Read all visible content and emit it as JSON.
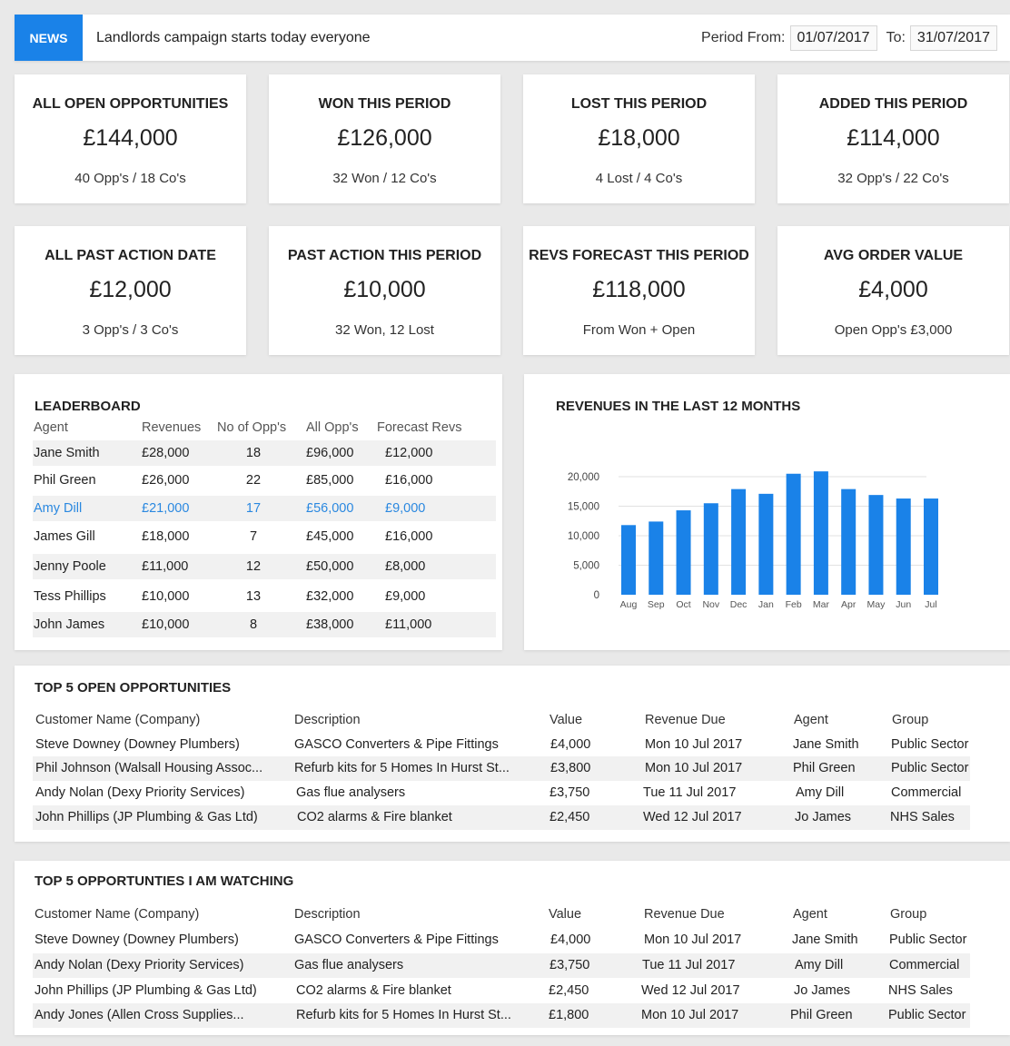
{
  "news": {
    "badge": "NEWS",
    "message": "Landlords campaign starts today everyone",
    "period_from_label": "Period From:",
    "period_from_value": "01/07/2017",
    "period_to_label": "To:",
    "period_to_value": "31/07/2017"
  },
  "kpis": [
    {
      "title": "ALL OPEN OPPORTUNITIES",
      "value": "£144,000",
      "sub": "40 Opp's  / 18 Co's"
    },
    {
      "title": "WON THIS PERIOD",
      "value": "£126,000",
      "sub": "32 Won / 12 Co's"
    },
    {
      "title": "LOST THIS PERIOD",
      "value": "£18,000",
      "sub": "4 Lost / 4 Co's"
    },
    {
      "title": "ADDED THIS PERIOD",
      "value": "£114,000",
      "sub": "32 Opp's  / 22 Co's"
    },
    {
      "title": "ALL PAST ACTION DATE",
      "value": "£12,000",
      "sub": "3 Opp's  / 3 Co's"
    },
    {
      "title": "PAST ACTION THIS PERIOD",
      "value": "£10,000",
      "sub": "32 Won, 12 Lost"
    },
    {
      "title": "REVS FORECAST THIS PERIOD",
      "value": "£118,000",
      "sub": "From Won + Open"
    },
    {
      "title": "AVG ORDER VALUE",
      "value": "£4,000",
      "sub": "Open Opp's £3,000"
    }
  ],
  "leaderboard": {
    "title": "LEADERBOARD",
    "headers": [
      "Agent",
      "Revenues",
      "No of Opp's",
      "All Opp's",
      "Forecast Revs"
    ],
    "rows": [
      {
        "agent": "Jane Smith",
        "revenues": "£28,000",
        "opps": "18",
        "all": "£96,000",
        "forecast": "£12,000"
      },
      {
        "agent": "Phil Green",
        "revenues": "£26,000",
        "opps": "22",
        "all": "£85,000",
        "forecast": "£16,000"
      },
      {
        "agent": "Amy Dill",
        "revenues": "£21,000",
        "opps": "17",
        "all": "£56,000",
        "forecast": "£9,000"
      },
      {
        "agent": "James Gill",
        "revenues": "£18,000",
        "opps": "7",
        "all": "£45,000",
        "forecast": "£16,000"
      },
      {
        "agent": "Jenny Poole",
        "revenues": "£11,000",
        "opps": "12",
        "all": "£50,000",
        "forecast": "£8,000"
      },
      {
        "agent": "Tess Phillips",
        "revenues": "£10,000",
        "opps": "13",
        "all": "£32,000",
        "forecast": "£9,000"
      },
      {
        "agent": "John James",
        "revenues": "£10,000",
        "opps": "8",
        "all": "£38,000",
        "forecast": "£11,000"
      }
    ],
    "highlight_color": "#2a88e0"
  },
  "chart_data": {
    "type": "bar",
    "title": "REVENUES IN THE LAST 12 MONTHS",
    "categories": [
      "Aug",
      "Sep",
      "Oct",
      "Nov",
      "Dec",
      "Jan",
      "Feb",
      "Mar",
      "Apr",
      "May",
      "Jun",
      "Jul"
    ],
    "values": [
      11800,
      12400,
      14300,
      15500,
      17900,
      17100,
      20500,
      20900,
      17900,
      16900,
      16300,
      16300
    ],
    "yticks": [
      "0",
      "5,000",
      "10,000",
      "15,000",
      "20,000"
    ],
    "ylim": [
      0,
      22000
    ],
    "grid": true,
    "bar_color": "#1a82e8"
  },
  "open_opportunities": {
    "title": "TOP 5 OPEN OPPORTUNITIES",
    "headers": [
      "Customer Name (Company)",
      "Description",
      "Value",
      "Revenue Due",
      "Agent",
      "Group"
    ],
    "rows": [
      [
        "Steve Downey (Downey Plumbers)",
        "GASCO Converters & Pipe Fittings",
        "£4,000",
        "Mon 10 Jul 2017",
        "Jane Smith",
        "Public Sector"
      ],
      [
        "Phil Johnson (Walsall Housing Assoc...",
        "Refurb kits for 5 Homes In Hurst St...",
        "£3,800",
        "Mon 10 Jul 2017",
        "Phil Green",
        "Public Sector"
      ],
      [
        "Andy Nolan (Dexy Priority Services)",
        "Gas flue analysers",
        "£3,750",
        "Tue 11 Jul 2017",
        "Amy Dill",
        "Commercial"
      ],
      [
        "John Phillips (JP Plumbing & Gas Ltd)",
        "CO2 alarms & Fire blanket",
        "£2,450",
        "Wed 12 Jul 2017",
        "Jo James",
        "NHS Sales"
      ]
    ]
  },
  "watching_opportunities": {
    "title": "TOP 5 OPPORTUNTIES I AM WATCHING",
    "headers": [
      "Customer Name (Company)",
      "Description",
      "Value",
      "Revenue Due",
      "Agent",
      "Group"
    ],
    "rows": [
      [
        "Steve Downey (Downey Plumbers)",
        "GASCO Converters & Pipe Fittings",
        "£4,000",
        "Mon 10 Jul 2017",
        "Jane Smith",
        "Public Sector"
      ],
      [
        "Andy Nolan (Dexy Priority Services)",
        "Gas flue analysers",
        "£3,750",
        "Tue 11 Jul 2017",
        "Amy Dill",
        "Commercial"
      ],
      [
        "John Phillips (JP Plumbing & Gas Ltd)",
        "CO2 alarms & Fire blanket",
        "£2,450",
        "Wed 12 Jul 2017",
        "Jo James",
        "NHS Sales"
      ],
      [
        "Andy Jones (Allen Cross Supplies...",
        "Refurb kits for 5 Homes In Hurst St...",
        "£1,800",
        "Mon 10 Jul 2017",
        "Phil Green",
        "Public Sector"
      ]
    ]
  }
}
